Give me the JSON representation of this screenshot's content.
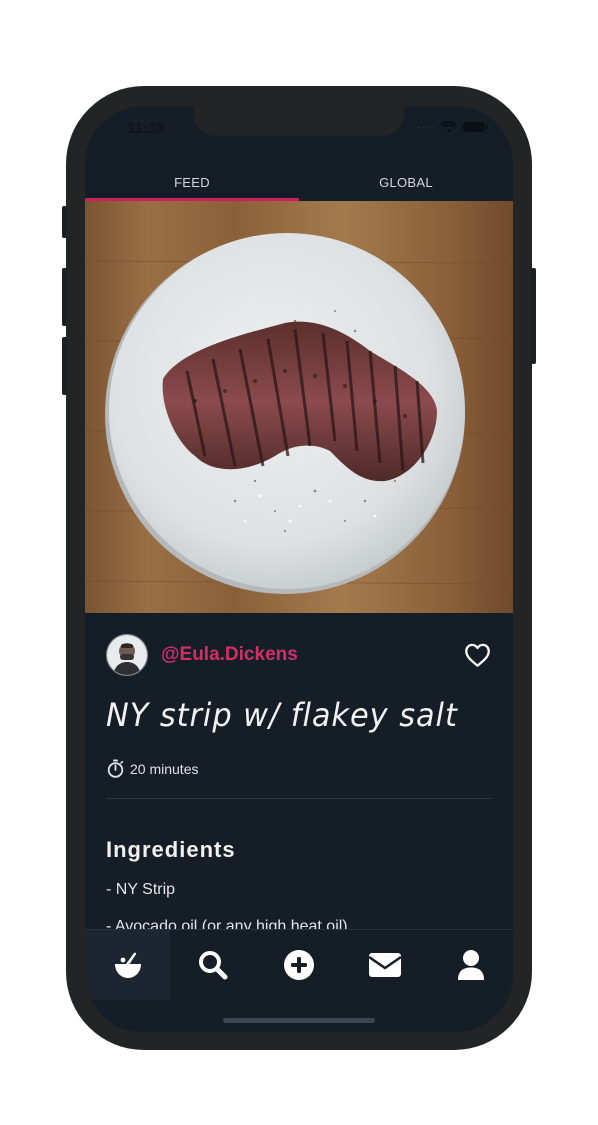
{
  "status_bar": {
    "time": "11:33"
  },
  "tabs": [
    {
      "label": "FEED",
      "active": true
    },
    {
      "label": "GLOBAL",
      "active": false
    }
  ],
  "post": {
    "username": "@Eula.Dickens",
    "title": "NY strip w/ flakey salt",
    "cook_time": "20 minutes",
    "liked": false
  },
  "ingredients_section": {
    "heading": "Ingredients",
    "items": [
      "- NY Strip",
      "- Avocado oil (or any high heat oil)"
    ]
  },
  "bottom_nav": [
    {
      "icon": "bowl-icon",
      "active": true
    },
    {
      "icon": "search-icon",
      "active": false
    },
    {
      "icon": "plus-circle-icon",
      "active": false
    },
    {
      "icon": "envelope-icon",
      "active": false
    },
    {
      "icon": "user-icon",
      "active": false
    }
  ],
  "colors": {
    "accent": "#cc1f5e",
    "username": "#d12f66",
    "background": "#151d27"
  }
}
